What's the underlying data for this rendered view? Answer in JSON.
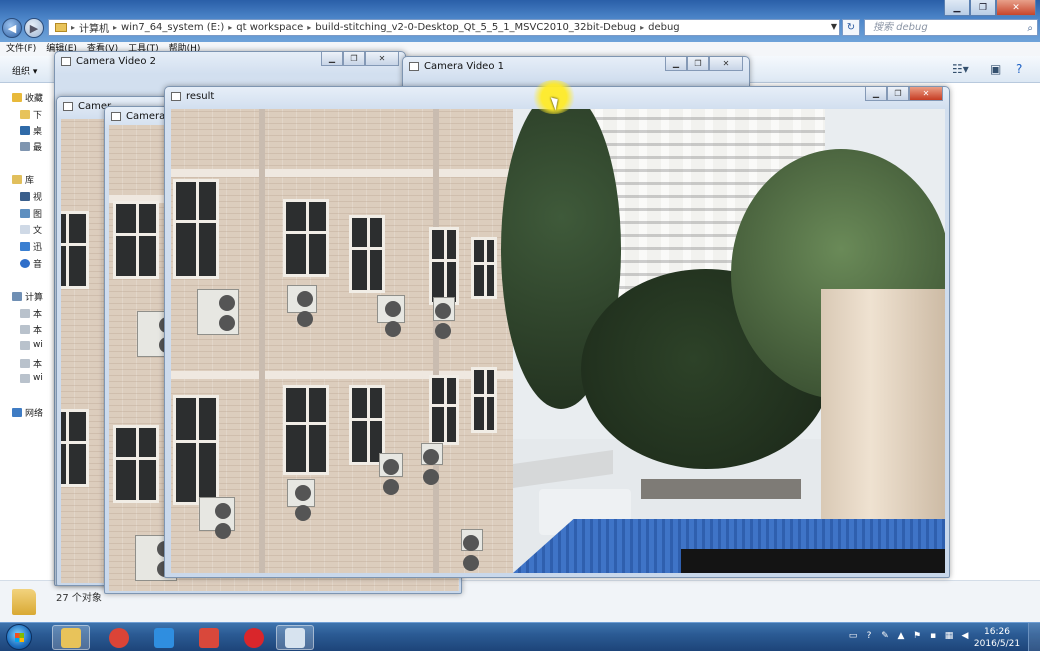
{
  "explorer": {
    "address": {
      "root": "计算机",
      "segments": [
        "win7_64_system (E:)",
        "qt workspace",
        "build-stitching_v2-0-Desktop_Qt_5_5_1_MSVC2010_32bit-Debug",
        "debug"
      ]
    },
    "search_placeholder": "搜索 debug",
    "menu": [
      "文件(F)",
      "编辑(E)",
      "查看(V)",
      "工具(T)",
      "帮助(H)"
    ],
    "toolbar": {
      "organize": "组织 ▾"
    },
    "sidebar": {
      "items": [
        {
          "label": "收藏",
          "icon": "star-icon"
        },
        {
          "label": "下",
          "icon": "download-icon"
        },
        {
          "label": "桌",
          "icon": "desktop-icon"
        },
        {
          "label": "最",
          "icon": "recent-icon"
        },
        {
          "label": "库",
          "icon": "library-icon"
        },
        {
          "label": "视",
          "icon": "video-icon"
        },
        {
          "label": "图",
          "icon": "picture-icon"
        },
        {
          "label": "文",
          "icon": "document-icon"
        },
        {
          "label": "迅",
          "icon": "thunder-icon"
        },
        {
          "label": "音",
          "icon": "music-icon"
        },
        {
          "label": "计算",
          "icon": "computer-icon"
        },
        {
          "label": "本",
          "icon": "disk-icon"
        },
        {
          "label": "本",
          "icon": "disk-icon"
        },
        {
          "label": "wi",
          "icon": "disk-icon"
        },
        {
          "label": "本",
          "icon": "disk-icon"
        },
        {
          "label": "wi",
          "icon": "disk-icon"
        },
        {
          "label": "网络",
          "icon": "network-icon"
        }
      ]
    },
    "status": {
      "count": "27 个对象"
    }
  },
  "windows": {
    "camera2": {
      "title": "Camera Video 2"
    },
    "camera1": {
      "title": "Camera Video 1"
    },
    "camera_small_a": {
      "title": "Camer"
    },
    "camera_small_b": {
      "title": "Camera V"
    },
    "result": {
      "title": "result"
    }
  },
  "taskbar": {
    "apps": [
      {
        "name": "explorer-taskbar-icon",
        "color": "#e8c35a"
      },
      {
        "name": "chrome-taskbar-icon",
        "color": "#db4437"
      },
      {
        "name": "qq-taskbar-icon",
        "color": "#2f8ee0"
      },
      {
        "name": "paint-taskbar-icon",
        "color": "#d9483b"
      },
      {
        "name": "opera-taskbar-icon",
        "color": "#d9262b"
      },
      {
        "name": "app-window-taskbar-icon",
        "color": "#d7e3ef"
      }
    ],
    "clock": {
      "time": "16:26",
      "date": "2016/5/21"
    }
  }
}
